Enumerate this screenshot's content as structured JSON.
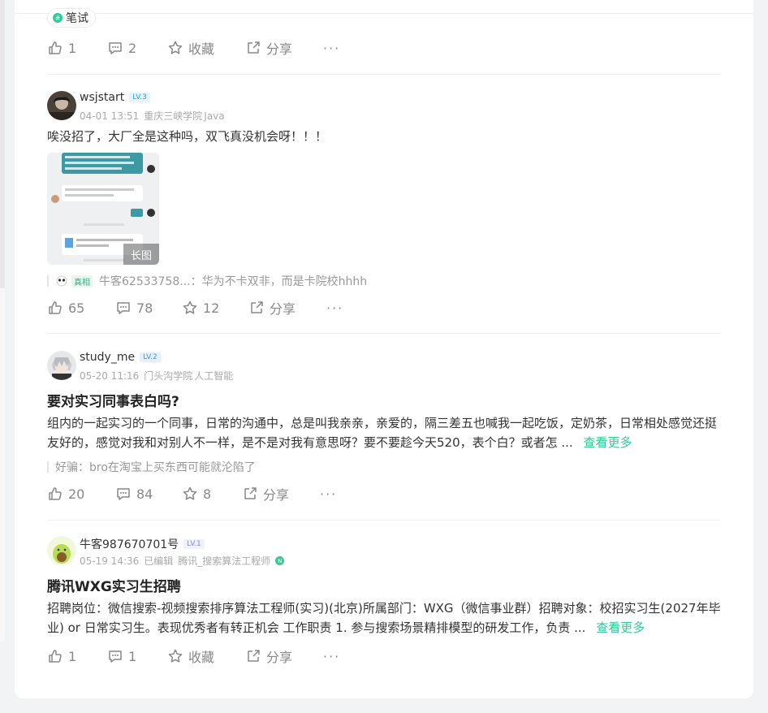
{
  "colors": {
    "accent": "#32ca99",
    "muted": "#888888",
    "lv_blue": "#3a9bdc"
  },
  "top_tag": {
    "label": "笔试"
  },
  "posts": [
    {
      "actions": {
        "like": "1",
        "comment": "2",
        "collect": "收藏",
        "share": "分享",
        "more": "···"
      }
    },
    {
      "author": "wsjstart",
      "level": "LV.3",
      "date": "04-01 13:51",
      "school": "重庆三峡学院",
      "direction": "Java",
      "text": "唉没招了，大厂全是这种吗，双飞真没机会呀！！！",
      "image_tag": "长图",
      "comment_badge": "真相",
      "comment_user": "牛客62533758...",
      "comment_text": "：华为不卡双非，而是卡院校hhhh",
      "actions": {
        "like": "65",
        "comment": "78",
        "collect": "12",
        "share": "分享",
        "more": "···"
      }
    },
    {
      "author": "study_me",
      "level": "LV.2",
      "date": "05-20 11:16",
      "school": "门头沟学院",
      "direction": "人工智能",
      "title": "要对实习同事表白吗?",
      "text": "组内的一起实习的一个同事，日常的沟通中，总是叫我亲亲，亲爱的，隔三差五也喊我一起吃饭，定奶茶，日常相处感觉还挺友好的，感觉对我和对别人不一样，是不是对我有意思呀？要不要趁今天520，表个白？或者怎 ...",
      "more_link": "查看更多",
      "comment_user": "好骗",
      "comment_text": "：bro在淘宝上买东西可能就沦陷了",
      "actions": {
        "like": "20",
        "comment": "84",
        "collect": "8",
        "share": "分享",
        "more": "···"
      }
    },
    {
      "author": "牛客987670701号",
      "level": "LV.1",
      "date": "05-19 14:36",
      "edited": "已编辑",
      "company_role": "腾讯_搜索算法工程师",
      "title": "腾讯WXG实习生招聘",
      "text": "招聘岗位：微信搜索-视频搜索排序算法工程师(实习)(北京)所属部门：WXG（微信事业群）招聘对象：校招实习生(2027年毕业) or 日常实习生。表现优秀者有转正机会 工作职责 1. 参与搜索场景精排模型的研发工作，负责 ...",
      "more_link": "查看更多",
      "actions": {
        "like": "1",
        "comment": "1",
        "collect": "收藏",
        "share": "分享",
        "more": "···"
      }
    }
  ]
}
